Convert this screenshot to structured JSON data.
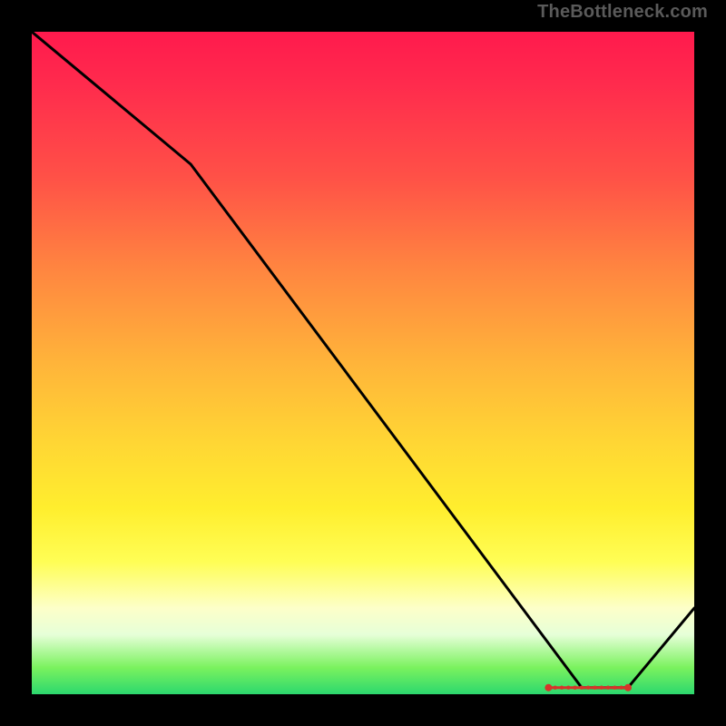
{
  "watermark": "TheBottleneck.com",
  "chart_data": {
    "type": "line",
    "title": "",
    "xlabel": "",
    "ylabel": "",
    "xlim": [
      0,
      100
    ],
    "ylim": [
      0,
      100
    ],
    "x": [
      0,
      24,
      83,
      90,
      100
    ],
    "values": [
      100,
      80,
      1,
      1,
      13
    ],
    "marker_band": {
      "y": 1,
      "x_start": 78,
      "x_end": 90
    },
    "gradient_stops": [
      {
        "pos": 0.0,
        "color": "#ff1a4d"
      },
      {
        "pos": 0.5,
        "color": "#ffb43a"
      },
      {
        "pos": 0.8,
        "color": "#fffe55"
      },
      {
        "pos": 1.0,
        "color": "#2cd86e"
      }
    ]
  }
}
